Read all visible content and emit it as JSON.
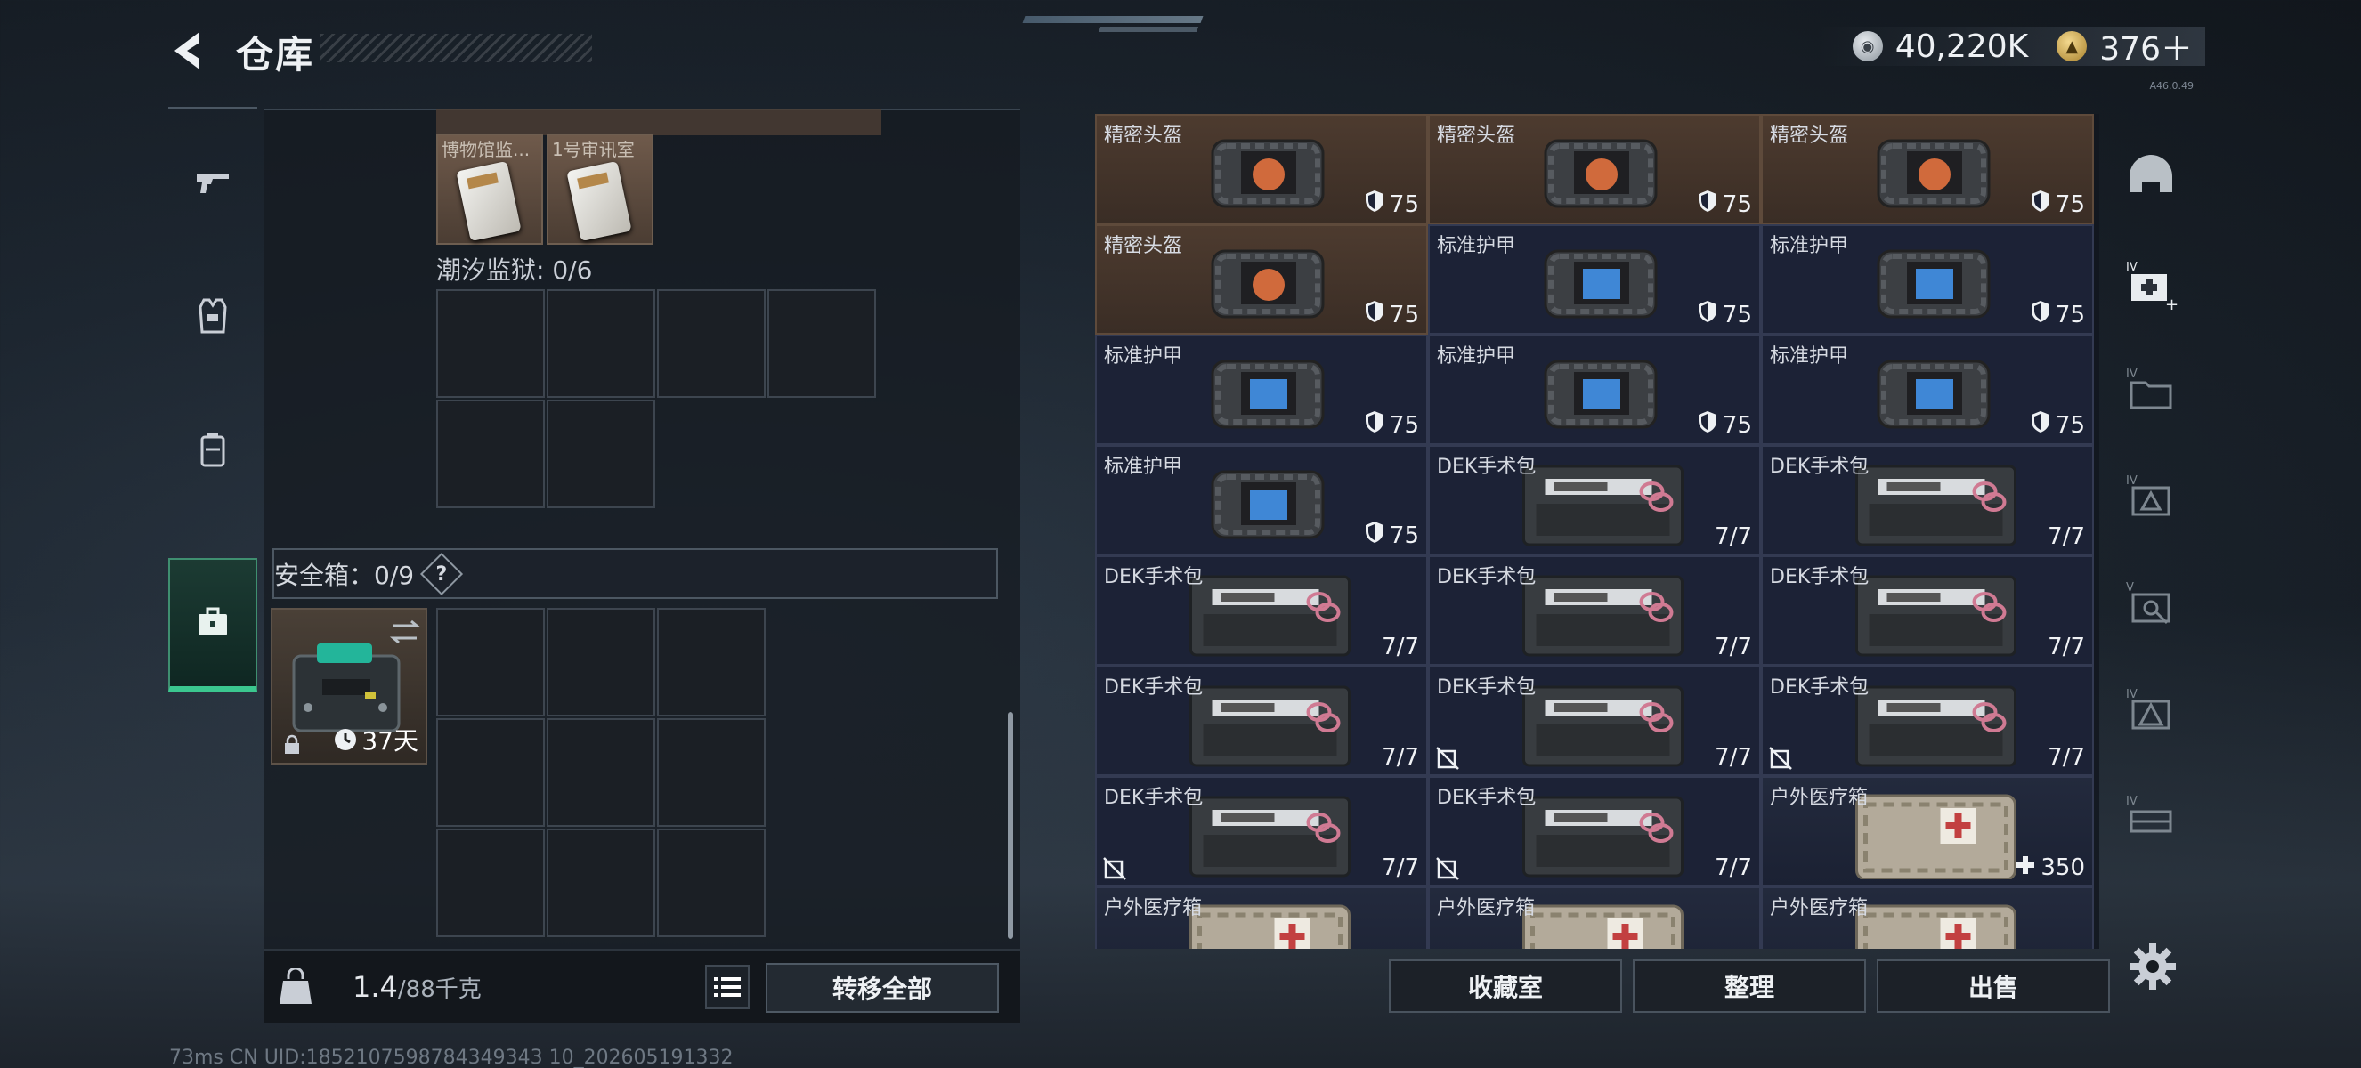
{
  "header": {
    "title": "仓库"
  },
  "currency": {
    "silver": "40,220K",
    "gold": "376＋"
  },
  "version_text": "A46.0.49",
  "left": {
    "mini_items": [
      {
        "label": "博物馆监..."
      },
      {
        "label": "1号审讯室"
      }
    ],
    "section1_label": "潮汐监狱: 0/6",
    "safe_label": "安全箱：0/9",
    "help": "?",
    "safe_time": "37天",
    "weight_value": "1.4",
    "weight_total": "/88千克",
    "transfer_label": "转移全部"
  },
  "stash": {
    "items": [
      {
        "name": "精密头盔",
        "value": "75",
        "kind": "helmet",
        "nosell": false
      },
      {
        "name": "精密头盔",
        "value": "75",
        "kind": "helmet",
        "nosell": false
      },
      {
        "name": "精密头盔",
        "value": "75",
        "kind": "helmet",
        "nosell": false
      },
      {
        "name": "精密头盔",
        "value": "75",
        "kind": "helmet",
        "nosell": false
      },
      {
        "name": "标准护甲",
        "value": "75",
        "kind": "armor",
        "nosell": false
      },
      {
        "name": "标准护甲",
        "value": "75",
        "kind": "armor",
        "nosell": false
      },
      {
        "name": "标准护甲",
        "value": "75",
        "kind": "armor",
        "nosell": false
      },
      {
        "name": "标准护甲",
        "value": "75",
        "kind": "armor",
        "nosell": false
      },
      {
        "name": "标准护甲",
        "value": "75",
        "kind": "armor",
        "nosell": false
      },
      {
        "name": "标准护甲",
        "value": "75",
        "kind": "armor",
        "nosell": false
      },
      {
        "name": "DEK手术包",
        "value": "7/7",
        "kind": "kit",
        "nosell": false
      },
      {
        "name": "DEK手术包",
        "value": "7/7",
        "kind": "kit",
        "nosell": false
      },
      {
        "name": "DEK手术包",
        "value": "7/7",
        "kind": "kit",
        "nosell": false
      },
      {
        "name": "DEK手术包",
        "value": "7/7",
        "kind": "kit",
        "nosell": false
      },
      {
        "name": "DEK手术包",
        "value": "7/7",
        "kind": "kit",
        "nosell": false
      },
      {
        "name": "DEK手术包",
        "value": "7/7",
        "kind": "kit",
        "nosell": false
      },
      {
        "name": "DEK手术包",
        "value": "7/7",
        "kind": "kit",
        "nosell": true
      },
      {
        "name": "DEK手术包",
        "value": "7/7",
        "kind": "kit",
        "nosell": true
      },
      {
        "name": "DEK手术包",
        "value": "7/7",
        "kind": "kit",
        "nosell": true
      },
      {
        "name": "DEK手术包",
        "value": "7/7",
        "kind": "kit",
        "nosell": true
      },
      {
        "name": "户外医疗箱",
        "value": "350",
        "kind": "medbox",
        "nosell": false
      },
      {
        "name": "户外医疗箱",
        "value": "",
        "kind": "medbox",
        "nosell": false
      },
      {
        "name": "户外医疗箱",
        "value": "",
        "kind": "medbox",
        "nosell": false
      },
      {
        "name": "户外医疗箱",
        "value": "",
        "kind": "medbox",
        "nosell": false
      }
    ]
  },
  "footer": {
    "collection": "收藏室",
    "sort": "整理",
    "sell": "出售"
  },
  "status_line": "73ms    CN UID:1852107598784349343 10_202605191332"
}
